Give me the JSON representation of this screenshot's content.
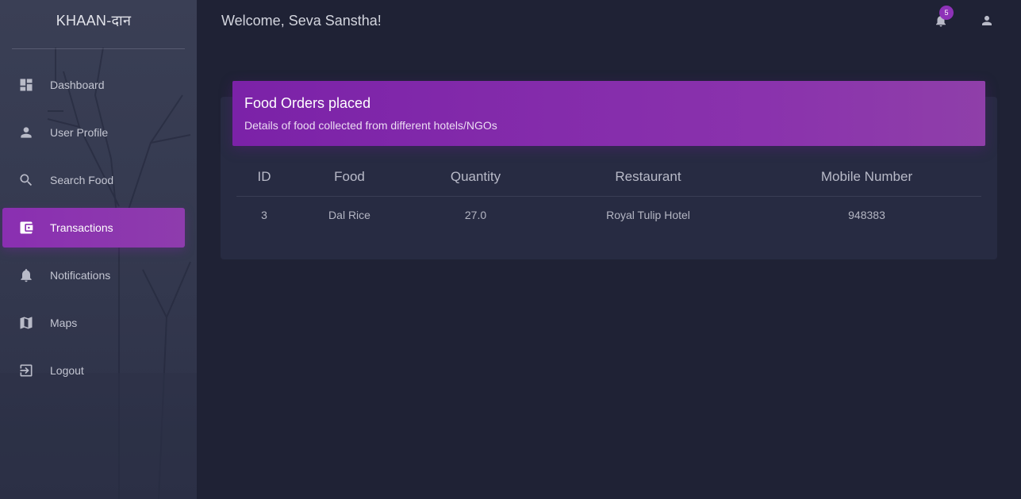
{
  "brand": "KHAAN-दान",
  "welcome": "Welcome, Seva Sanstha!",
  "notifications_count": "5",
  "sidebar": {
    "items": [
      {
        "label": "Dashboard",
        "icon": "dashboard-icon"
      },
      {
        "label": "User Profile",
        "icon": "person-icon"
      },
      {
        "label": "Search Food",
        "icon": "search-icon"
      },
      {
        "label": "Transactions",
        "icon": "wallet-icon",
        "active": true
      },
      {
        "label": "Notifications",
        "icon": "bell-icon"
      },
      {
        "label": "Maps",
        "icon": "map-icon"
      },
      {
        "label": "Logout",
        "icon": "logout-icon"
      }
    ]
  },
  "card": {
    "title": "Food Orders placed",
    "subtitle": "Details of food collected from different hotels/NGOs",
    "columns": [
      "ID",
      "Food",
      "Quantity",
      "Restaurant",
      "Mobile Number"
    ],
    "rows": [
      [
        "3",
        "Dal Rice",
        "27.0",
        "Royal Tulip Hotel",
        "948383"
      ]
    ]
  },
  "colors": {
    "accent": "#8a2fb1",
    "background": "#1f2235",
    "card": "#272b42"
  }
}
